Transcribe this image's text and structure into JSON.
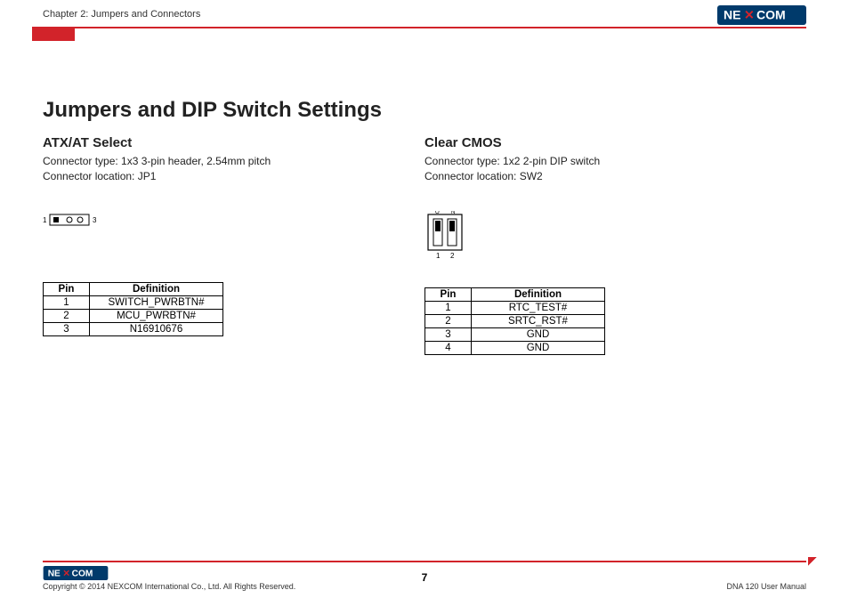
{
  "header": {
    "chapter": "Chapter 2: Jumpers and Connectors",
    "brand": "NEXCOM"
  },
  "title": "Jumpers and DIP Switch Settings",
  "left": {
    "subtitle": "ATX/AT Select",
    "desc1": "Connector type: 1x3 3-pin header, 2.54mm pitch",
    "desc2": "Connector location: JP1",
    "pin_label_left": "1",
    "pin_label_right": "3",
    "table": {
      "header_pin": "Pin",
      "header_def": "Definition",
      "rows": [
        {
          "pin": "1",
          "def": "SWITCH_PWRBTN#"
        },
        {
          "pin": "2",
          "def": "MCU_PWRBTN#"
        },
        {
          "pin": "3",
          "def": "N16910676"
        }
      ]
    }
  },
  "right": {
    "subtitle": "Clear CMOS",
    "desc1": "Connector type: 1x2 2-pin DIP switch",
    "desc2": "Connector location: SW2",
    "dip_label_1": "1",
    "dip_label_2": "2",
    "table": {
      "header_pin": "Pin",
      "header_def": "Definition",
      "rows": [
        {
          "pin": "1",
          "def": "RTC_TEST#"
        },
        {
          "pin": "2",
          "def": "SRTC_RST#"
        },
        {
          "pin": "3",
          "def": "GND"
        },
        {
          "pin": "4",
          "def": "GND"
        }
      ]
    }
  },
  "footer": {
    "copyright": "Copyright © 2014 NEXCOM International Co., Ltd. All Rights Reserved.",
    "page": "7",
    "manual": "DNA 120 User Manual"
  }
}
